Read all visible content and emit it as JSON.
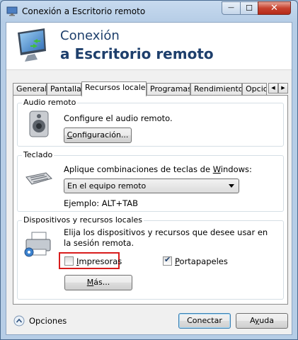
{
  "window": {
    "title": "Conexión a Escritorio remoto",
    "minimize_symbol": "—",
    "maximize_symbol": "☐",
    "close_symbol": "✕"
  },
  "banner": {
    "line1": "Conexión",
    "line2": "a Escritorio remoto"
  },
  "tabs": [
    {
      "label": "General"
    },
    {
      "label": "Pantalla"
    },
    {
      "label": "Recursos locales",
      "selected": true
    },
    {
      "label": "Programas"
    },
    {
      "label": "Rendimiento"
    },
    {
      "label": "Opcio"
    }
  ],
  "audio": {
    "group_label": "Audio remoto",
    "description": "Configure el audio remoto.",
    "button": {
      "text": "onfiguración...",
      "mnemonic": "C"
    }
  },
  "keyboard": {
    "group_label": "Teclado",
    "description_prefix": "Aplique combinaciones de teclas de ",
    "description_mnemonic": "W",
    "description_suffix": "indows:",
    "selected_option": "En el equipo remoto",
    "example": "Ejemplo: ALT+TAB"
  },
  "devices": {
    "group_label": "Dispositivos y recursos locales",
    "description": "Elija los dispositivos y recursos que desee usar en la sesión remota.",
    "printers": {
      "mnemonic": "I",
      "text": "mpresoras",
      "checked": false
    },
    "clipboard": {
      "mnemonic": "P",
      "text": "ortapapeles",
      "checked": true
    },
    "more_button": {
      "mnemonic": "M",
      "text": "ás..."
    }
  },
  "footer": {
    "options_label": "Opciones",
    "options_mnemonic": "O",
    "connect_button": "Conectar",
    "help_button": {
      "mnemonic": "y",
      "prefix": "A",
      "suffix": "uda"
    }
  },
  "colors": {
    "highlight": "#d81d1d",
    "banner_text": "#1e3f6c"
  }
}
